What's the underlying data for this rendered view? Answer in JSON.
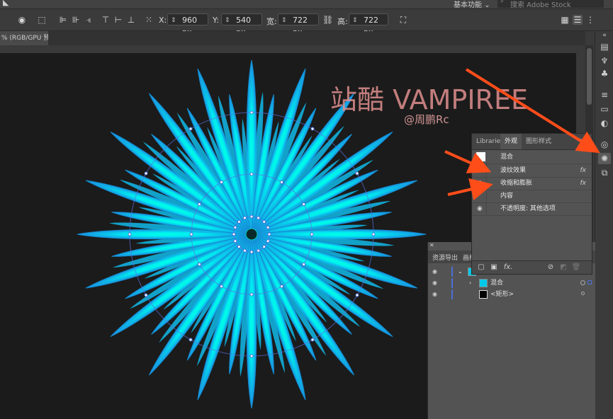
{
  "app": {
    "workspace_label": "基本功能",
    "workspace_chevron": "⌄",
    "stock_search_placeholder": "搜索 Adobe Stock"
  },
  "control_bar": {
    "x_label": "X:",
    "x_value": "960 px",
    "y_label": "Y:",
    "y_value": "540 px",
    "w_label": "宽:",
    "w_value": "722 px",
    "h_label": "高:",
    "h_value": "722 px"
  },
  "document_tab": {
    "label": "% (RGB/GPU 预览)"
  },
  "watermark": {
    "title": "站酷 VAMPIREE",
    "handle": "@周鹏Rc"
  },
  "appearance_panel": {
    "tabs": [
      {
        "label": "Libraries",
        "active": false
      },
      {
        "label": "外观",
        "active": true
      },
      {
        "label": "图形样式",
        "active": false
      }
    ],
    "header": "混合",
    "rows": [
      {
        "label": "波纹效果",
        "visible": true,
        "fx": "fx"
      },
      {
        "label": "收缩和膨胀",
        "visible": true,
        "fx": "fx"
      },
      {
        "label": "内容",
        "visible": false,
        "fx": ""
      },
      {
        "label": "不透明度: 其他选项",
        "visible": true,
        "fx": ""
      }
    ],
    "footer_icons": [
      "square-icon",
      "filled-square-icon",
      "fx-icon",
      "clear-icon",
      "duplicate-icon",
      "trash-icon"
    ]
  },
  "layers_panel": {
    "tabs": [
      "资源导出",
      "画板"
    ],
    "rows": [
      {
        "name": "",
        "visible": true,
        "expanded": true,
        "thumb_color": "#00c8e8"
      },
      {
        "name": "混合",
        "visible": true,
        "expanded": false,
        "thumb_color": "#00c8e8"
      },
      {
        "name": "<矩形>",
        "visible": true,
        "expanded": false,
        "thumb_color": "#000000"
      }
    ]
  },
  "colors": {
    "canvas_bg": "#1b1b1b",
    "flower_core": "#00ffe6",
    "flower_petal": "#1aa0e0",
    "watermark": "#e08f8f",
    "arrow": "#ff4d1a"
  },
  "artwork": {
    "petal_count": 40
  }
}
